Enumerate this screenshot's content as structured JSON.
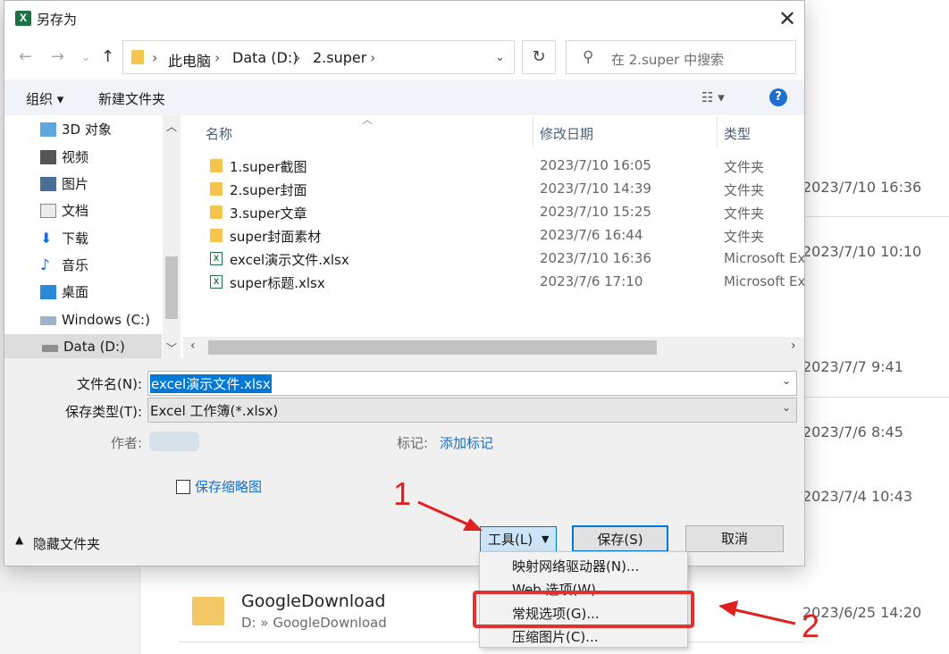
{
  "background": {
    "dates": [
      "2023/7/10 16:36",
      "2023/7/10 10:10",
      "2023/7/7 9:41",
      "2023/7/6 8:45",
      "2023/7/4 10:43",
      "2023/6/25 14:20"
    ],
    "google_folder": {
      "name": "GoogleDownload",
      "path": "D: » GoogleDownload"
    }
  },
  "dialog": {
    "title": "另存为",
    "breadcrumb": [
      "此电脑",
      "Data (D:)",
      "2.super"
    ],
    "search_placeholder": "在 2.super 中搜索",
    "toolbar": {
      "organize": "组织 ▾",
      "new_folder": "新建文件夹"
    },
    "help_label": "?",
    "sidebar": [
      {
        "label": "3D 对象",
        "icon": "3d-objects-icon"
      },
      {
        "label": "视频",
        "icon": "video-icon"
      },
      {
        "label": "图片",
        "icon": "pictures-icon"
      },
      {
        "label": "文档",
        "icon": "documents-icon"
      },
      {
        "label": "下载",
        "icon": "downloads-icon"
      },
      {
        "label": "音乐",
        "icon": "music-icon"
      },
      {
        "label": "桌面",
        "icon": "desktop-icon"
      },
      {
        "label": "Windows (C:)",
        "icon": "drive-c-icon"
      },
      {
        "label": "Data (D:)",
        "icon": "drive-d-icon"
      }
    ],
    "columns": {
      "name": "名称",
      "modified": "修改日期",
      "type": "类型"
    },
    "files": [
      {
        "name": "1.super截图",
        "date": "2023/7/10 16:05",
        "type": "文件夹",
        "kind": "folder"
      },
      {
        "name": "2.super封面",
        "date": "2023/7/10 14:39",
        "type": "文件夹",
        "kind": "folder"
      },
      {
        "name": "3.super文章",
        "date": "2023/7/10 15:25",
        "type": "文件夹",
        "kind": "folder"
      },
      {
        "name": "super封面素材",
        "date": "2023/7/6 16:44",
        "type": "文件夹",
        "kind": "folder"
      },
      {
        "name": "excel演示文件.xlsx",
        "date": "2023/7/10 16:36",
        "type": "Microsoft Ex",
        "kind": "xlsx"
      },
      {
        "name": "super标题.xlsx",
        "date": "2023/7/6 17:10",
        "type": "Microsoft Ex",
        "kind": "xlsx"
      }
    ],
    "filename_label": "文件名(N):",
    "filename_value": "excel演示文件.xlsx",
    "filetype_label": "保存类型(T):",
    "filetype_value": "Excel 工作簿(*.xlsx)",
    "author_label": "作者:",
    "tags_label": "标记:",
    "tags_value": "添加标记",
    "thumbnail_label": "保存缩略图",
    "hide_folders": "隐藏文件夹",
    "tools_button": "工具(L)",
    "save_button": "保存(S)",
    "cancel_button": "取消"
  },
  "tools_menu": [
    "映射网络驱动器(N)...",
    "Web 选项(W)...",
    "常规选项(G)...",
    "压缩图片(C)..."
  ],
  "annotations": {
    "step1": "1",
    "step2": "2"
  },
  "colors": {
    "accent": "#0078d7",
    "annotation": "#e02020",
    "excel_green": "#1e7145"
  }
}
